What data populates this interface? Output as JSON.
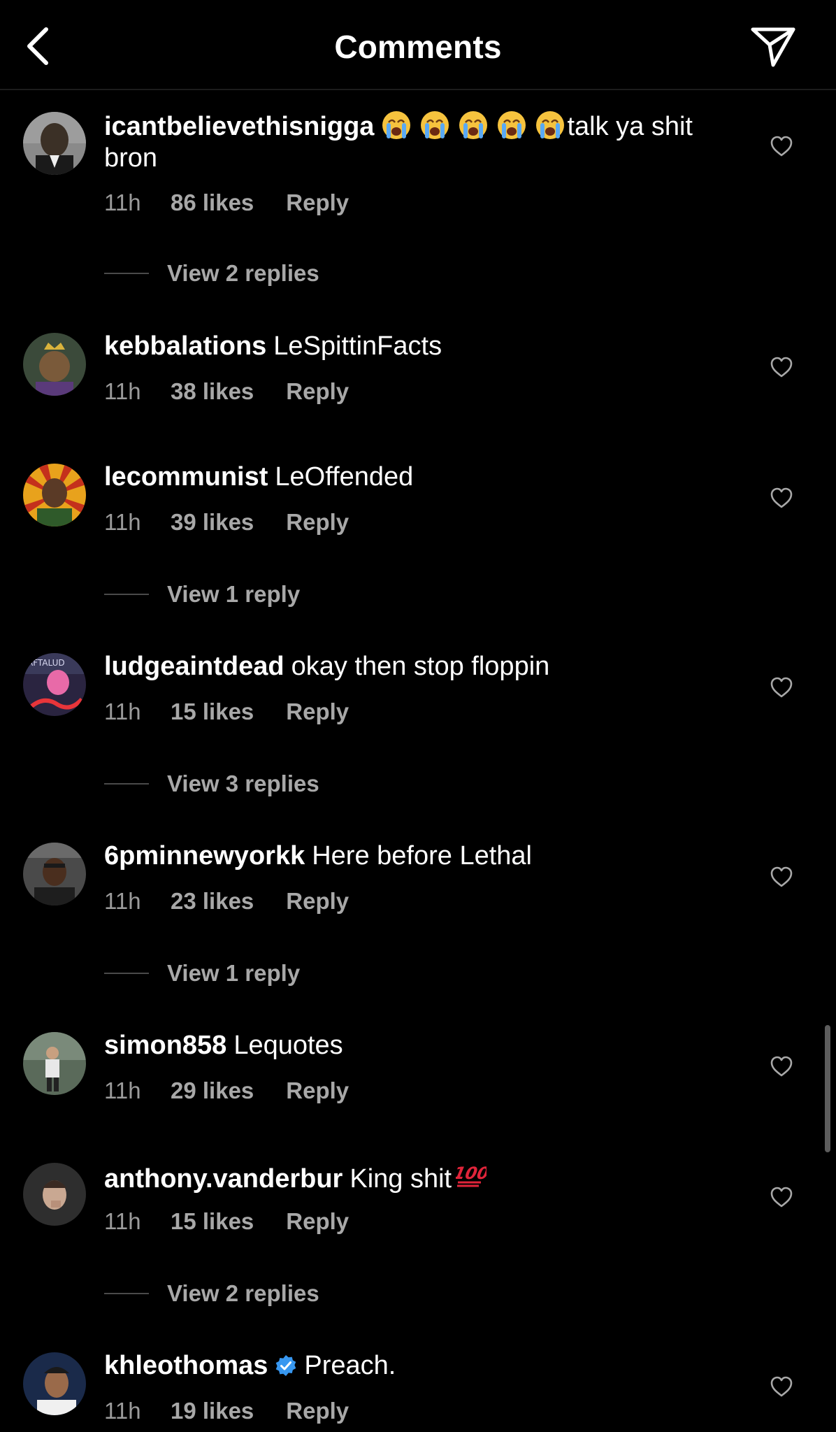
{
  "header": {
    "title": "Comments"
  },
  "comments": [
    {
      "username": "icantbelievethisnigga",
      "text": "talk ya shit bron",
      "emoji_before_text": [
        "loudly-crying-face",
        "loudly-crying-face",
        "loudly-crying-face",
        "loudly-crying-face",
        "loudly-crying-face"
      ],
      "time": "11h",
      "likes": "86 likes",
      "reply_label": "Reply",
      "view_replies": "View 2 replies"
    },
    {
      "username": "kebbalations",
      "text": "LeSpittinFacts",
      "time": "11h",
      "likes": "38 likes",
      "reply_label": "Reply"
    },
    {
      "username": "lecommunist",
      "text": "LeOffended",
      "time": "11h",
      "likes": "39 likes",
      "reply_label": "Reply",
      "view_replies": "View 1 reply"
    },
    {
      "username": "ludgeaintdead",
      "text": "okay then stop floppin",
      "time": "11h",
      "likes": "15 likes",
      "reply_label": "Reply",
      "view_replies": "View 3 replies"
    },
    {
      "username": "6pminnewyorkk",
      "text": "Here before Lethal",
      "time": "11h",
      "likes": "23 likes",
      "reply_label": "Reply",
      "view_replies": "View 1 reply"
    },
    {
      "username": "simon858",
      "text": "Lequotes",
      "time": "11h",
      "likes": "29 likes",
      "reply_label": "Reply"
    },
    {
      "username": "anthony.vanderbur",
      "text": "King shit",
      "emoji_after_text": "hundred-points",
      "time": "11h",
      "likes": "15 likes",
      "reply_label": "Reply",
      "view_replies": "View 2 replies"
    },
    {
      "username": "khleothomas",
      "verified": true,
      "text": "Preach.",
      "time": "11h",
      "likes": "19 likes",
      "reply_label": "Reply"
    }
  ],
  "icons": {
    "back": "chevron-left-icon",
    "send": "paper-plane-icon",
    "like": "heart-outline-icon",
    "verified": "verified-badge-icon"
  },
  "colors": {
    "background": "#000000",
    "primary_text": "#ffffff",
    "secondary_text": "#a8a8a8",
    "verified_blue": "#3797f0",
    "hundred_red": "#e0243a"
  }
}
